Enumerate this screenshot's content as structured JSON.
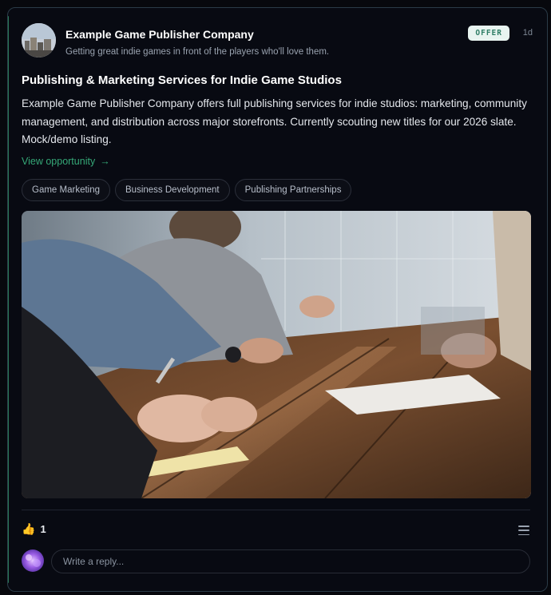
{
  "post": {
    "company_name": "Example Game Publisher Company",
    "tagline": "Getting great indie games in front of the players who'll love them.",
    "badge": "OFFER",
    "age": "1d",
    "title": "Publishing & Marketing Services for Indie Game Studios",
    "description": "Example Game Publisher Company offers full publishing services for indie studios: marketing, community management, and distribution across major storefronts. Currently scouting new titles for our 2026 slate. Mock/demo listing.",
    "view_link": "View opportunity",
    "tags": [
      "Game Marketing",
      "Business Development",
      "Publishing Partnerships"
    ]
  },
  "reactions": {
    "emoji": "👍",
    "count": "1"
  },
  "reply": {
    "placeholder": "Write a reply..."
  },
  "colors": {
    "accent": "#35a877",
    "badge_bg": "#e8f4f0",
    "badge_text": "#2f7e66",
    "card_bg": "#080a12"
  },
  "icons": {
    "link_arrow": "arrow-right-icon",
    "menu": "menu-icon"
  }
}
